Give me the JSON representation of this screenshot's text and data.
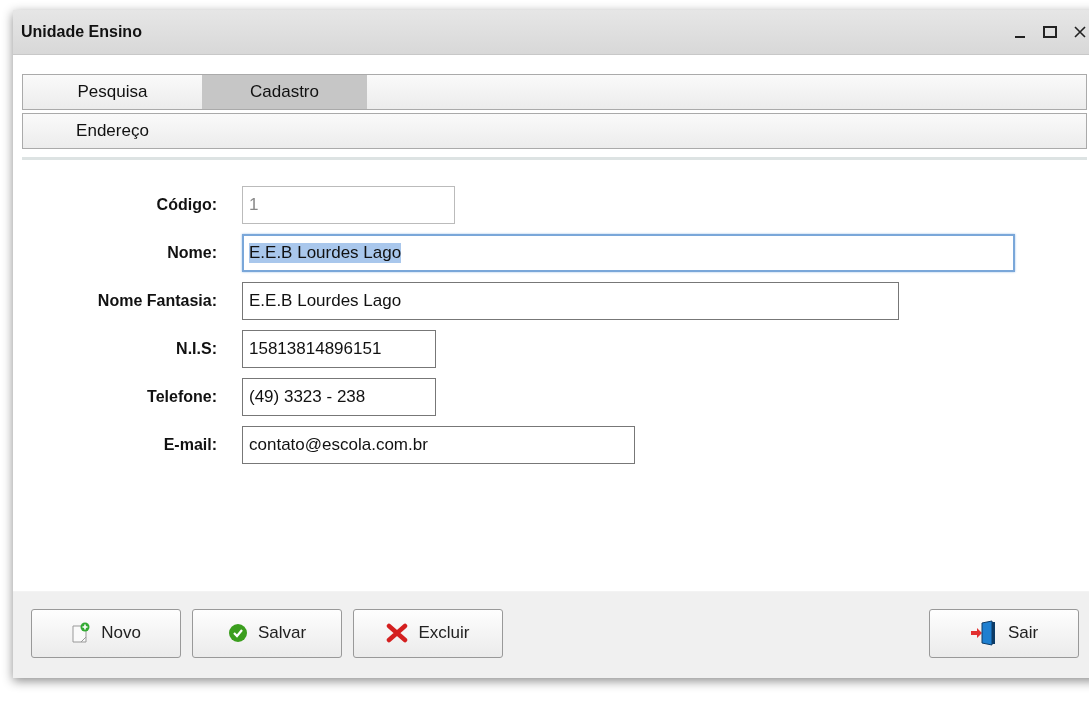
{
  "window": {
    "title": "Unidade Ensino"
  },
  "tab_rows": [
    {
      "tabs": [
        {
          "label": "Pesquisa",
          "selected": false
        },
        {
          "label": "Cadastro",
          "selected": true
        }
      ]
    },
    {
      "tabs": [
        {
          "label": "Endereço",
          "selected": false
        }
      ]
    }
  ],
  "form": {
    "fields": [
      {
        "label": "Código:",
        "value": "1",
        "disabled": true,
        "focused": false
      },
      {
        "label": "Nome:",
        "value": "E.E.B Lourdes Lago",
        "disabled": false,
        "focused": true
      },
      {
        "label": "Nome Fantasia:",
        "value": "E.E.B Lourdes Lago",
        "disabled": false,
        "focused": false
      },
      {
        "label": "N.I.S:",
        "value": "15813814896151",
        "disabled": false,
        "focused": false
      },
      {
        "label": "Telefone:",
        "value": "(49) 3323 - 238",
        "disabled": false,
        "focused": false
      },
      {
        "label": "E-mail:",
        "value": "contato@escola.com.br",
        "disabled": false,
        "focused": false
      }
    ]
  },
  "buttons": [
    {
      "label": "Novo",
      "kind": "new"
    },
    {
      "label": "Salvar",
      "kind": "save"
    },
    {
      "label": "Excluir",
      "kind": "delete"
    },
    {
      "label": "Sair",
      "kind": "exit"
    }
  ]
}
